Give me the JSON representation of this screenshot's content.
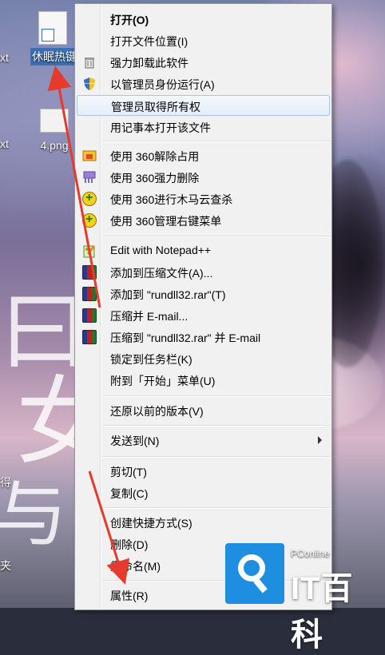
{
  "desktop": {
    "icons": [
      {
        "label": "休眠热键"
      },
      {
        "label": "4.png"
      }
    ],
    "side_texts": [
      "xt",
      "xt",
      "得",
      "夹"
    ]
  },
  "context_menu": {
    "items": [
      {
        "label": "打开(O)",
        "icon": "none"
      },
      {
        "label": "打开文件位置(I)",
        "icon": "none"
      },
      {
        "label": "强力卸载此软件",
        "icon": "trash-icon"
      },
      {
        "label": "以管理员身份运行(A)",
        "icon": "uac-shield-icon"
      },
      {
        "label": "管理员取得所有权",
        "icon": "none"
      },
      {
        "label": "用记事本打开该文件",
        "icon": "none"
      },
      {
        "label": "使用 360解除占用",
        "icon": "360-unlock-icon"
      },
      {
        "label": "使用 360强力删除",
        "icon": "360-shred-icon"
      },
      {
        "label": "使用 360进行木马云查杀",
        "icon": "360-scan-icon"
      },
      {
        "label": "使用 360管理右键菜单",
        "icon": "360-menu-icon"
      },
      {
        "label": "Edit with Notepad++",
        "icon": "notepadpp-icon"
      },
      {
        "label": "添加到压缩文件(A)...",
        "icon": "winrar-icon"
      },
      {
        "label": "添加到 \"rundll32.rar\"(T)",
        "icon": "winrar-icon"
      },
      {
        "label": "压缩并 E-mail...",
        "icon": "winrar-icon"
      },
      {
        "label": "压缩到 \"rundll32.rar\" 并 E-mail",
        "icon": "winrar-icon"
      },
      {
        "label": "锁定到任务栏(K)",
        "icon": "none"
      },
      {
        "label": "附到「开始」菜单(U)",
        "icon": "none"
      },
      {
        "label": "还原以前的版本(V)",
        "icon": "none"
      },
      {
        "label": "发送到(N)",
        "icon": "none"
      },
      {
        "label": "剪切(T)",
        "icon": "none"
      },
      {
        "label": "复制(C)",
        "icon": "none"
      },
      {
        "label": "创建快捷方式(S)",
        "icon": "none"
      },
      {
        "label": "删除(D)",
        "icon": "none"
      },
      {
        "label": "重命名(M)",
        "icon": "none"
      },
      {
        "label": "属性(R)",
        "icon": "none"
      }
    ]
  },
  "watermark": {
    "small": "PConline",
    "big": "IT百科"
  },
  "colors": {
    "arrow_red": "#e53a2c",
    "highlight_border": "#a9c6ea",
    "menu_bg": "#f1f1f1",
    "watermark_blue": "#1e8fe0"
  }
}
